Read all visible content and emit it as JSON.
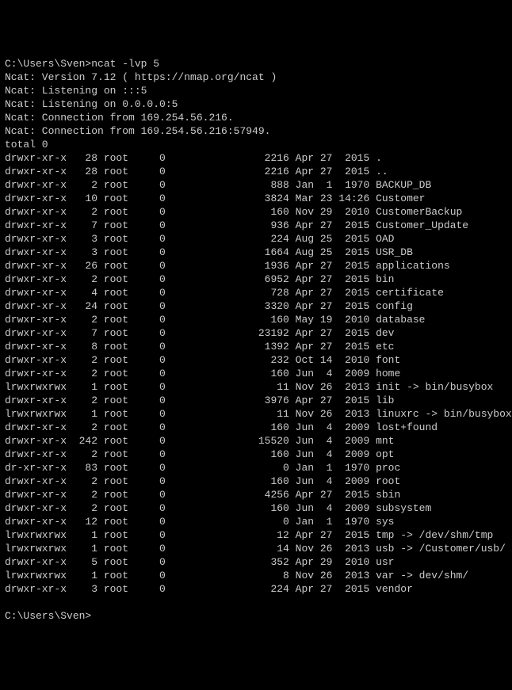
{
  "prompt1": "C:\\Users\\Sven>",
  "command1": "ncat -lvp 5",
  "ncat_lines": [
    "Ncat: Version 7.12 ( https://nmap.org/ncat )",
    "Ncat: Listening on :::5",
    "Ncat: Listening on 0.0.0.0:5",
    "Ncat: Connection from 169.254.56.216.",
    "Ncat: Connection from 169.254.56.216:57949."
  ],
  "total_line": "total 0",
  "entries": [
    {
      "perm": "drwxr-xr-x",
      "links": "28",
      "owner": "root",
      "group": "0",
      "size": "2216",
      "date": "Apr 27  2015",
      "name": "."
    },
    {
      "perm": "drwxr-xr-x",
      "links": "28",
      "owner": "root",
      "group": "0",
      "size": "2216",
      "date": "Apr 27  2015",
      "name": ".."
    },
    {
      "perm": "drwxr-xr-x",
      "links": "2",
      "owner": "root",
      "group": "0",
      "size": "888",
      "date": "Jan  1  1970",
      "name": "BACKUP_DB"
    },
    {
      "perm": "drwxr-xr-x",
      "links": "10",
      "owner": "root",
      "group": "0",
      "size": "3824",
      "date": "Mar 23 14:26",
      "name": "Customer"
    },
    {
      "perm": "drwxr-xr-x",
      "links": "2",
      "owner": "root",
      "group": "0",
      "size": "160",
      "date": "Nov 29  2010",
      "name": "CustomerBackup"
    },
    {
      "perm": "drwxr-xr-x",
      "links": "7",
      "owner": "root",
      "group": "0",
      "size": "936",
      "date": "Apr 27  2015",
      "name": "Customer_Update"
    },
    {
      "perm": "drwxr-xr-x",
      "links": "3",
      "owner": "root",
      "group": "0",
      "size": "224",
      "date": "Aug 25  2015",
      "name": "OAD"
    },
    {
      "perm": "drwxr-xr-x",
      "links": "3",
      "owner": "root",
      "group": "0",
      "size": "1664",
      "date": "Aug 25  2015",
      "name": "USR_DB"
    },
    {
      "perm": "drwxr-xr-x",
      "links": "26",
      "owner": "root",
      "group": "0",
      "size": "1936",
      "date": "Apr 27  2015",
      "name": "applications"
    },
    {
      "perm": "drwxr-xr-x",
      "links": "2",
      "owner": "root",
      "group": "0",
      "size": "6952",
      "date": "Apr 27  2015",
      "name": "bin"
    },
    {
      "perm": "drwxr-xr-x",
      "links": "4",
      "owner": "root",
      "group": "0",
      "size": "728",
      "date": "Apr 27  2015",
      "name": "certificate"
    },
    {
      "perm": "drwxr-xr-x",
      "links": "24",
      "owner": "root",
      "group": "0",
      "size": "3320",
      "date": "Apr 27  2015",
      "name": "config"
    },
    {
      "perm": "drwxr-xr-x",
      "links": "2",
      "owner": "root",
      "group": "0",
      "size": "160",
      "date": "May 19  2010",
      "name": "database"
    },
    {
      "perm": "drwxr-xr-x",
      "links": "7",
      "owner": "root",
      "group": "0",
      "size": "23192",
      "date": "Apr 27  2015",
      "name": "dev"
    },
    {
      "perm": "drwxr-xr-x",
      "links": "8",
      "owner": "root",
      "group": "0",
      "size": "1392",
      "date": "Apr 27  2015",
      "name": "etc"
    },
    {
      "perm": "drwxr-xr-x",
      "links": "2",
      "owner": "root",
      "group": "0",
      "size": "232",
      "date": "Oct 14  2010",
      "name": "font"
    },
    {
      "perm": "drwxr-xr-x",
      "links": "2",
      "owner": "root",
      "group": "0",
      "size": "160",
      "date": "Jun  4  2009",
      "name": "home"
    },
    {
      "perm": "lrwxrwxrwx",
      "links": "1",
      "owner": "root",
      "group": "0",
      "size": "11",
      "date": "Nov 26  2013",
      "name": "init -> bin/busybox"
    },
    {
      "perm": "drwxr-xr-x",
      "links": "2",
      "owner": "root",
      "group": "0",
      "size": "3976",
      "date": "Apr 27  2015",
      "name": "lib"
    },
    {
      "perm": "lrwxrwxrwx",
      "links": "1",
      "owner": "root",
      "group": "0",
      "size": "11",
      "date": "Nov 26  2013",
      "name": "linuxrc -> bin/busybox"
    },
    {
      "perm": "drwxr-xr-x",
      "links": "2",
      "owner": "root",
      "group": "0",
      "size": "160",
      "date": "Jun  4  2009",
      "name": "lost+found"
    },
    {
      "perm": "drwxr-xr-x",
      "links": "242",
      "owner": "root",
      "group": "0",
      "size": "15520",
      "date": "Jun  4  2009",
      "name": "mnt"
    },
    {
      "perm": "drwxr-xr-x",
      "links": "2",
      "owner": "root",
      "group": "0",
      "size": "160",
      "date": "Jun  4  2009",
      "name": "opt"
    },
    {
      "perm": "dr-xr-xr-x",
      "links": "83",
      "owner": "root",
      "group": "0",
      "size": "0",
      "date": "Jan  1  1970",
      "name": "proc"
    },
    {
      "perm": "drwxr-xr-x",
      "links": "2",
      "owner": "root",
      "group": "0",
      "size": "160",
      "date": "Jun  4  2009",
      "name": "root"
    },
    {
      "perm": "drwxr-xr-x",
      "links": "2",
      "owner": "root",
      "group": "0",
      "size": "4256",
      "date": "Apr 27  2015",
      "name": "sbin"
    },
    {
      "perm": "drwxr-xr-x",
      "links": "2",
      "owner": "root",
      "group": "0",
      "size": "160",
      "date": "Jun  4  2009",
      "name": "subsystem"
    },
    {
      "perm": "drwxr-xr-x",
      "links": "12",
      "owner": "root",
      "group": "0",
      "size": "0",
      "date": "Jan  1  1970",
      "name": "sys"
    },
    {
      "perm": "lrwxrwxrwx",
      "links": "1",
      "owner": "root",
      "group": "0",
      "size": "12",
      "date": "Apr 27  2015",
      "name": "tmp -> /dev/shm/tmp"
    },
    {
      "perm": "lrwxrwxrwx",
      "links": "1",
      "owner": "root",
      "group": "0",
      "size": "14",
      "date": "Nov 26  2013",
      "name": "usb -> /Customer/usb/"
    },
    {
      "perm": "drwxr-xr-x",
      "links": "5",
      "owner": "root",
      "group": "0",
      "size": "352",
      "date": "Apr 29  2010",
      "name": "usr"
    },
    {
      "perm": "lrwxrwxrwx",
      "links": "1",
      "owner": "root",
      "group": "0",
      "size": "8",
      "date": "Nov 26  2013",
      "name": "var -> dev/shm/"
    },
    {
      "perm": "drwxr-xr-x",
      "links": "3",
      "owner": "root",
      "group": "0",
      "size": "224",
      "date": "Apr 27  2015",
      "name": "vendor"
    }
  ],
  "prompt2": "C:\\Users\\Sven>"
}
